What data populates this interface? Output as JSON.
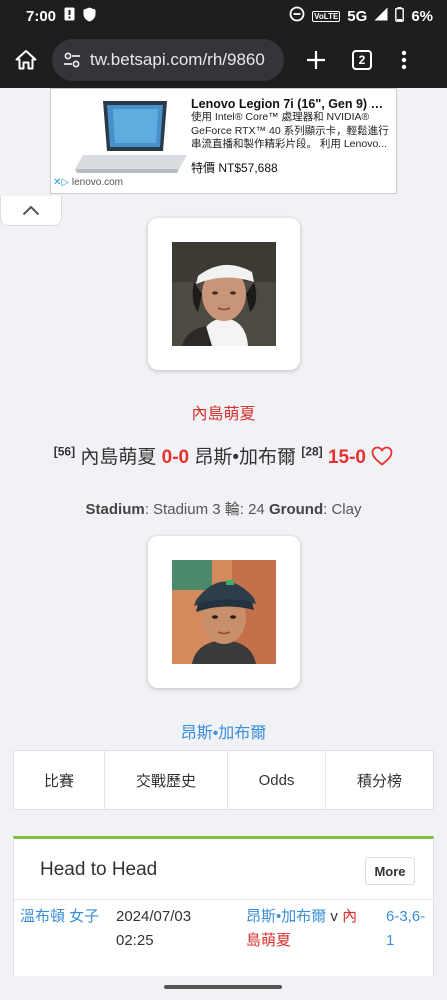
{
  "status_bar": {
    "time": "7:00",
    "network": "5G",
    "lte_badge": "VoLTE",
    "battery": "6%"
  },
  "browser": {
    "url": "tw.betsapi.com/rh/9860",
    "tab_count": "2"
  },
  "ad": {
    "title": "Lenovo Legion 7i (16\", Gen 9) 第 ...",
    "description": "使用 Intel® Core™ 處理器和 NVIDIA® GeForce RTX™ 40 系列顯示卡，輕鬆進行串流直播和製作精彩片段。 利用 Lenovo...",
    "price": "特價 NT$57,688",
    "domain": "lenovo.com"
  },
  "match": {
    "player1_name": "內島萌夏",
    "player1_rank": "[56]",
    "player1_score": "0-0",
    "player2_name": "昂斯•加布爾",
    "player2_rank": "[28]",
    "game_score": "15-0",
    "stadium_label": "Stadium",
    "stadium_value": ": Stadium 3 輪: 24 ",
    "ground_label": "Ground",
    "ground_value": ": Clay"
  },
  "tabs": [
    "比賽",
    "交戰歷史",
    "Odds",
    "積分榜"
  ],
  "h2h": {
    "title": "Head to Head",
    "more_label": "More",
    "rows": [
      {
        "tournament": "溫布頓 女子",
        "date": "2024/07/03",
        "time": "02:25",
        "home": "昂斯•加布爾",
        "vs": " v ",
        "away": "內島萌夏",
        "result": "6-3,6-1"
      }
    ]
  },
  "colors": {
    "accent_red": "#d9302c",
    "accent_blue": "#3a8fd8",
    "panel_green": "#7cc242"
  }
}
